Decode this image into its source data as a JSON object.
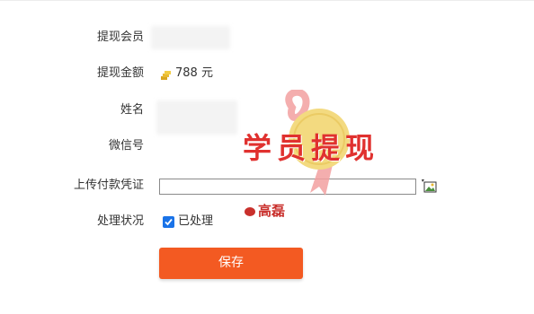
{
  "form": {
    "member_label": "提现会员",
    "amount_label": "提现金额",
    "amount_value": "788 元",
    "name_label": "姓名",
    "wechat_label": "微信号",
    "voucher_label": "上传付款凭证",
    "status_label": "处理状况",
    "status_checkbox_label": "已处理",
    "status_checked": true
  },
  "save_button": "保存",
  "watermark": {
    "main": "学员提现",
    "sub": "高磊"
  },
  "colors": {
    "accent": "#f35a22",
    "checkbox": "#1a73e8",
    "watermark": "#e0312f"
  },
  "icons": [
    "coin-icon",
    "image-upload-icon",
    "check-icon",
    "medal-watermark"
  ]
}
